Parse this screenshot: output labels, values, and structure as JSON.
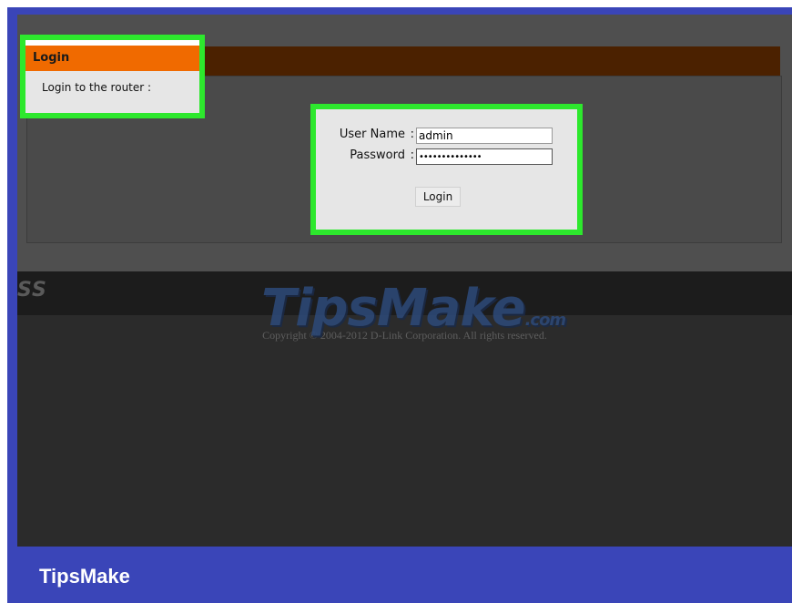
{
  "router_ui": {
    "login_section_title": "Login",
    "login_section_subtitle": "Login to the router :",
    "username_label": "User Name",
    "username_value": "admin",
    "password_label": "Password",
    "password_value": "••••••••••••••",
    "label_separator": ":",
    "login_button_label": "Login",
    "brand_fragment": "SS",
    "copyright": "Copyright © 2004-2012 D-Link Corporation. All rights reserved."
  },
  "watermark": {
    "text": "TipsMake",
    "suffix": ".com"
  },
  "footer": {
    "brand": "TipsMake"
  },
  "colors": {
    "highlight": "#2de82d",
    "login_title_bar": "#f06a00",
    "frame": "#3a45b8"
  }
}
